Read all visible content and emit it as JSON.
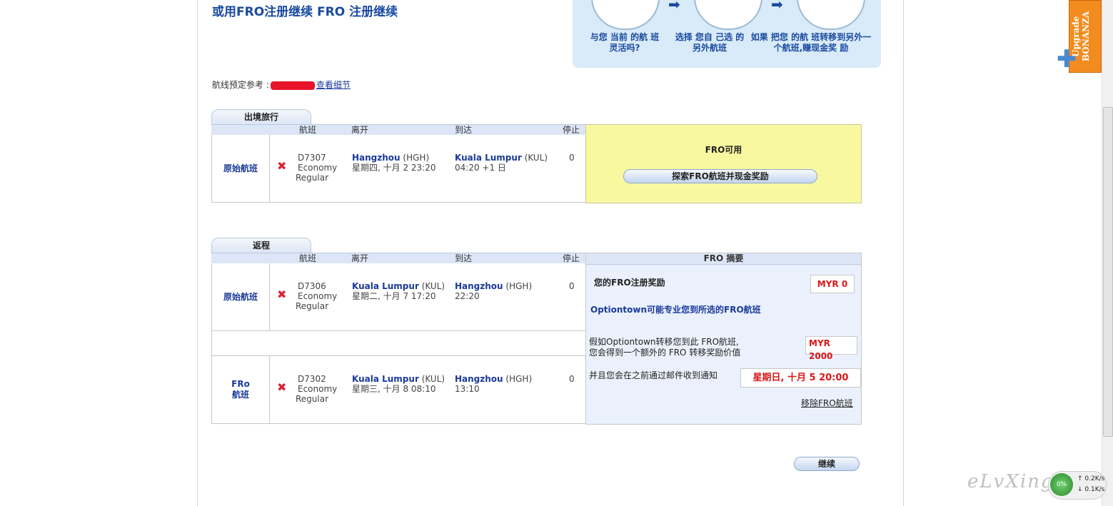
{
  "header": {
    "title": "或用FRO注册继续 FRO 注册继续"
  },
  "steps": [
    {
      "text": "与您 当前 的航 班 灵活吗?"
    },
    {
      "text": "选择 您自 己选 的另外航班"
    },
    {
      "text": "如果 把您 的航 班转移到另外一 个航班,赚现金奖 励"
    }
  ],
  "booking": {
    "ref_label": "航线预定参考 :",
    "details_link": "查看细节"
  },
  "columns": {
    "flight": "航班",
    "depart": "离开",
    "arrive": "到达",
    "stops": "停止"
  },
  "outbound": {
    "tab": "出境旅行",
    "row_label": "原始航班",
    "flight_no": "D7307",
    "cabin": "Economy",
    "fare": "Regular",
    "dep_city": "Hangzhou",
    "dep_code": "(HGH)",
    "dep_time": "星期四, 十月 2  23:20",
    "arr_city": "Kuala Lumpur",
    "arr_code": "(KUL)",
    "arr_time": "04:20 +1 日",
    "stops": "0",
    "fro_available": "FRO可用",
    "explore_button": "探索FRO航班并现金奖励"
  },
  "return": {
    "tab": "返程",
    "original": {
      "row_label": "原始航班",
      "flight_no": "D7306",
      "cabin": "Economy",
      "fare": "Regular",
      "dep_city": "Kuala Lumpur",
      "dep_code": "(KUL)",
      "dep_time": "星期二, 十月 7  17:20",
      "arr_city": "Hangzhou",
      "arr_code": "(HGH)",
      "arr_time": "22:20",
      "stops": "0"
    },
    "fro": {
      "row_label_1": "FRo",
      "row_label_2": "航班",
      "flight_no": "D7302",
      "cabin": "Economy",
      "fare": "Regular",
      "dep_city": "Kuala Lumpur",
      "dep_code": "(KUL)",
      "dep_time": "星期三, 十月 8  08:10",
      "arr_city": "Hangzhou",
      "arr_code": "(HGH)",
      "arr_time": "13:10",
      "stops": "0"
    }
  },
  "summary": {
    "header": "FRO 摘要",
    "reward_label": "您的FRO注册奖励",
    "reward_value": "MYR 0",
    "specialist_text": "Optiontown可能专业您到所选的FRO航班",
    "transfer_text_1": "假如Optiontown转移您到此 FRO航班,",
    "transfer_text_2": "您会得到一个额外的 FRO 转移奖励价值",
    "transfer_value": "MYR 2000",
    "notify_text": "并且您会在之前通过邮件收到通知",
    "notify_date": "星期日, 十月 5 20:00",
    "remove_link": "移除FRO航班"
  },
  "continue_button": "继续",
  "overlay": {
    "bonanza_line1": "Upgrade",
    "bonanza_line2": "BONANZA",
    "watermark": "eLvXing",
    "net_percent": "0%",
    "net_up": "0.2K/s",
    "net_down": "0.1K/s"
  },
  "colors": {
    "accent_blue": "#1a4aa0",
    "fro_yellow": "#f8f8a0",
    "value_red": "#d81818"
  }
}
